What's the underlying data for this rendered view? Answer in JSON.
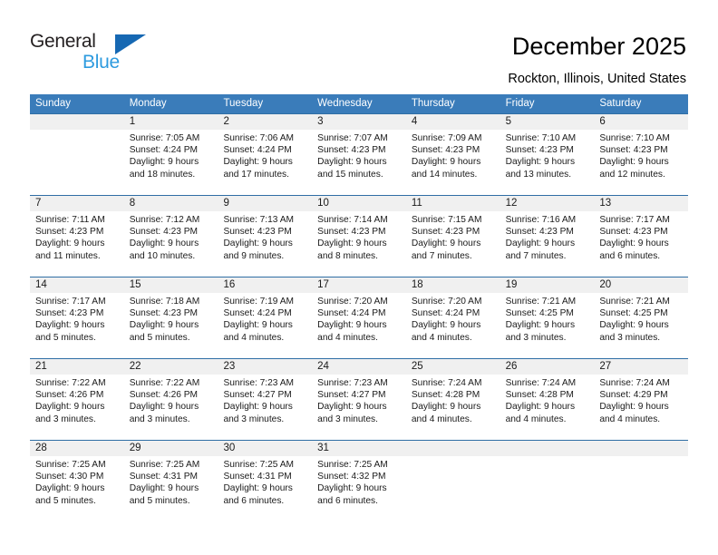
{
  "logo": {
    "word_top": "General",
    "word_bottom": "Blue",
    "triangle_color": "#1668b3",
    "blue_color": "#2e9bdf",
    "dark_color": "#231f20"
  },
  "header": {
    "title": "December 2025",
    "subtitle": "Rockton, Illinois, United States"
  },
  "theme": {
    "header_bg": "#3a7cba",
    "row_line": "#2f6ea5",
    "daynum_strip": "#f0f0f0"
  },
  "weekdays": [
    "Sunday",
    "Monday",
    "Tuesday",
    "Wednesday",
    "Thursday",
    "Friday",
    "Saturday"
  ],
  "weeks": [
    [
      {
        "day": "",
        "sunrise": "",
        "sunset": "",
        "daylight_1": "",
        "daylight_2": "",
        "empty": true
      },
      {
        "day": "1",
        "sunrise": "Sunrise: 7:05 AM",
        "sunset": "Sunset: 4:24 PM",
        "daylight_1": "Daylight: 9 hours",
        "daylight_2": "and 18 minutes."
      },
      {
        "day": "2",
        "sunrise": "Sunrise: 7:06 AM",
        "sunset": "Sunset: 4:24 PM",
        "daylight_1": "Daylight: 9 hours",
        "daylight_2": "and 17 minutes."
      },
      {
        "day": "3",
        "sunrise": "Sunrise: 7:07 AM",
        "sunset": "Sunset: 4:23 PM",
        "daylight_1": "Daylight: 9 hours",
        "daylight_2": "and 15 minutes."
      },
      {
        "day": "4",
        "sunrise": "Sunrise: 7:09 AM",
        "sunset": "Sunset: 4:23 PM",
        "daylight_1": "Daylight: 9 hours",
        "daylight_2": "and 14 minutes."
      },
      {
        "day": "5",
        "sunrise": "Sunrise: 7:10 AM",
        "sunset": "Sunset: 4:23 PM",
        "daylight_1": "Daylight: 9 hours",
        "daylight_2": "and 13 minutes."
      },
      {
        "day": "6",
        "sunrise": "Sunrise: 7:10 AM",
        "sunset": "Sunset: 4:23 PM",
        "daylight_1": "Daylight: 9 hours",
        "daylight_2": "and 12 minutes."
      }
    ],
    [
      {
        "day": "7",
        "sunrise": "Sunrise: 7:11 AM",
        "sunset": "Sunset: 4:23 PM",
        "daylight_1": "Daylight: 9 hours",
        "daylight_2": "and 11 minutes."
      },
      {
        "day": "8",
        "sunrise": "Sunrise: 7:12 AM",
        "sunset": "Sunset: 4:23 PM",
        "daylight_1": "Daylight: 9 hours",
        "daylight_2": "and 10 minutes."
      },
      {
        "day": "9",
        "sunrise": "Sunrise: 7:13 AM",
        "sunset": "Sunset: 4:23 PM",
        "daylight_1": "Daylight: 9 hours",
        "daylight_2": "and 9 minutes."
      },
      {
        "day": "10",
        "sunrise": "Sunrise: 7:14 AM",
        "sunset": "Sunset: 4:23 PM",
        "daylight_1": "Daylight: 9 hours",
        "daylight_2": "and 8 minutes."
      },
      {
        "day": "11",
        "sunrise": "Sunrise: 7:15 AM",
        "sunset": "Sunset: 4:23 PM",
        "daylight_1": "Daylight: 9 hours",
        "daylight_2": "and 7 minutes."
      },
      {
        "day": "12",
        "sunrise": "Sunrise: 7:16 AM",
        "sunset": "Sunset: 4:23 PM",
        "daylight_1": "Daylight: 9 hours",
        "daylight_2": "and 7 minutes."
      },
      {
        "day": "13",
        "sunrise": "Sunrise: 7:17 AM",
        "sunset": "Sunset: 4:23 PM",
        "daylight_1": "Daylight: 9 hours",
        "daylight_2": "and 6 minutes."
      }
    ],
    [
      {
        "day": "14",
        "sunrise": "Sunrise: 7:17 AM",
        "sunset": "Sunset: 4:23 PM",
        "daylight_1": "Daylight: 9 hours",
        "daylight_2": "and 5 minutes."
      },
      {
        "day": "15",
        "sunrise": "Sunrise: 7:18 AM",
        "sunset": "Sunset: 4:23 PM",
        "daylight_1": "Daylight: 9 hours",
        "daylight_2": "and 5 minutes."
      },
      {
        "day": "16",
        "sunrise": "Sunrise: 7:19 AM",
        "sunset": "Sunset: 4:24 PM",
        "daylight_1": "Daylight: 9 hours",
        "daylight_2": "and 4 minutes."
      },
      {
        "day": "17",
        "sunrise": "Sunrise: 7:20 AM",
        "sunset": "Sunset: 4:24 PM",
        "daylight_1": "Daylight: 9 hours",
        "daylight_2": "and 4 minutes."
      },
      {
        "day": "18",
        "sunrise": "Sunrise: 7:20 AM",
        "sunset": "Sunset: 4:24 PM",
        "daylight_1": "Daylight: 9 hours",
        "daylight_2": "and 4 minutes."
      },
      {
        "day": "19",
        "sunrise": "Sunrise: 7:21 AM",
        "sunset": "Sunset: 4:25 PM",
        "daylight_1": "Daylight: 9 hours",
        "daylight_2": "and 3 minutes."
      },
      {
        "day": "20",
        "sunrise": "Sunrise: 7:21 AM",
        "sunset": "Sunset: 4:25 PM",
        "daylight_1": "Daylight: 9 hours",
        "daylight_2": "and 3 minutes."
      }
    ],
    [
      {
        "day": "21",
        "sunrise": "Sunrise: 7:22 AM",
        "sunset": "Sunset: 4:26 PM",
        "daylight_1": "Daylight: 9 hours",
        "daylight_2": "and 3 minutes."
      },
      {
        "day": "22",
        "sunrise": "Sunrise: 7:22 AM",
        "sunset": "Sunset: 4:26 PM",
        "daylight_1": "Daylight: 9 hours",
        "daylight_2": "and 3 minutes."
      },
      {
        "day": "23",
        "sunrise": "Sunrise: 7:23 AM",
        "sunset": "Sunset: 4:27 PM",
        "daylight_1": "Daylight: 9 hours",
        "daylight_2": "and 3 minutes."
      },
      {
        "day": "24",
        "sunrise": "Sunrise: 7:23 AM",
        "sunset": "Sunset: 4:27 PM",
        "daylight_1": "Daylight: 9 hours",
        "daylight_2": "and 3 minutes."
      },
      {
        "day": "25",
        "sunrise": "Sunrise: 7:24 AM",
        "sunset": "Sunset: 4:28 PM",
        "daylight_1": "Daylight: 9 hours",
        "daylight_2": "and 4 minutes."
      },
      {
        "day": "26",
        "sunrise": "Sunrise: 7:24 AM",
        "sunset": "Sunset: 4:28 PM",
        "daylight_1": "Daylight: 9 hours",
        "daylight_2": "and 4 minutes."
      },
      {
        "day": "27",
        "sunrise": "Sunrise: 7:24 AM",
        "sunset": "Sunset: 4:29 PM",
        "daylight_1": "Daylight: 9 hours",
        "daylight_2": "and 4 minutes."
      }
    ],
    [
      {
        "day": "28",
        "sunrise": "Sunrise: 7:25 AM",
        "sunset": "Sunset: 4:30 PM",
        "daylight_1": "Daylight: 9 hours",
        "daylight_2": "and 5 minutes."
      },
      {
        "day": "29",
        "sunrise": "Sunrise: 7:25 AM",
        "sunset": "Sunset: 4:31 PM",
        "daylight_1": "Daylight: 9 hours",
        "daylight_2": "and 5 minutes."
      },
      {
        "day": "30",
        "sunrise": "Sunrise: 7:25 AM",
        "sunset": "Sunset: 4:31 PM",
        "daylight_1": "Daylight: 9 hours",
        "daylight_2": "and 6 minutes."
      },
      {
        "day": "31",
        "sunrise": "Sunrise: 7:25 AM",
        "sunset": "Sunset: 4:32 PM",
        "daylight_1": "Daylight: 9 hours",
        "daylight_2": "and 6 minutes."
      },
      {
        "day": "",
        "sunrise": "",
        "sunset": "",
        "daylight_1": "",
        "daylight_2": "",
        "empty": true
      },
      {
        "day": "",
        "sunrise": "",
        "sunset": "",
        "daylight_1": "",
        "daylight_2": "",
        "empty": true
      },
      {
        "day": "",
        "sunrise": "",
        "sunset": "",
        "daylight_1": "",
        "daylight_2": "",
        "empty": true
      }
    ]
  ]
}
